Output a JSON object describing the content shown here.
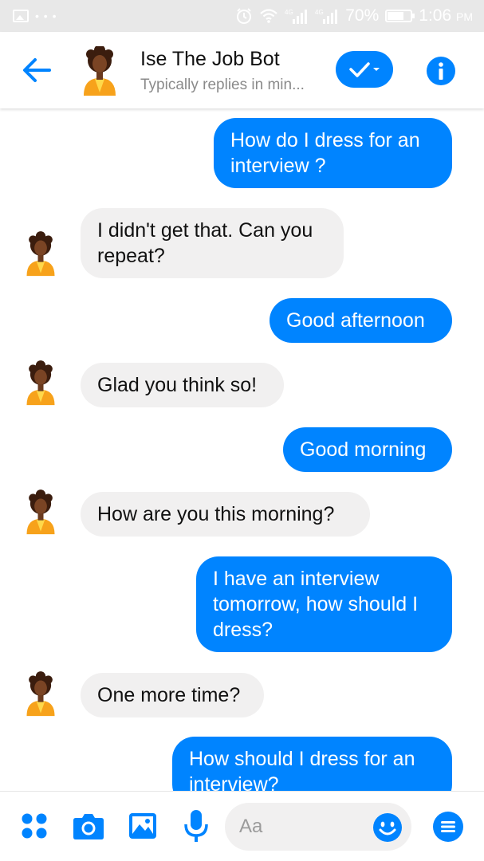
{
  "status_bar": {
    "signal_label_1": "4G",
    "signal_label_2": "4G",
    "battery": "70%",
    "battery_level": 0.7,
    "time": "1:06",
    "ampm": "PM"
  },
  "header": {
    "title": "Ise The Job Bot",
    "subtitle": "Typically replies in min..."
  },
  "messages": [
    {
      "from": "user",
      "text": "How do I dress for an interview ?"
    },
    {
      "from": "bot",
      "text": "I didn't get that. Can you repeat?"
    },
    {
      "from": "user",
      "text": "Good afternoon"
    },
    {
      "from": "bot",
      "text": "Glad you think so!"
    },
    {
      "from": "user",
      "text": "Good morning"
    },
    {
      "from": "bot",
      "text": "How are you this morning?"
    },
    {
      "from": "user",
      "text": "I have an interview tomorrow, how should I dress?"
    },
    {
      "from": "bot",
      "text": "One more time?"
    },
    {
      "from": "user",
      "text": "How should I dress for an interview?"
    }
  ],
  "composer": {
    "placeholder": "Aa"
  },
  "icons": {
    "back": "arrow-left-icon",
    "check": "check-dropdown-icon",
    "info": "info-icon",
    "more": "four-dots-icon",
    "camera": "camera-icon",
    "gallery": "image-icon",
    "mic": "microphone-icon",
    "emoji": "smiley-icon",
    "menu": "menu-icon"
  },
  "colors": {
    "accent": "#0084ff",
    "incoming_bubble": "#f1f0f0",
    "status_bar": "#e8e8e8"
  }
}
